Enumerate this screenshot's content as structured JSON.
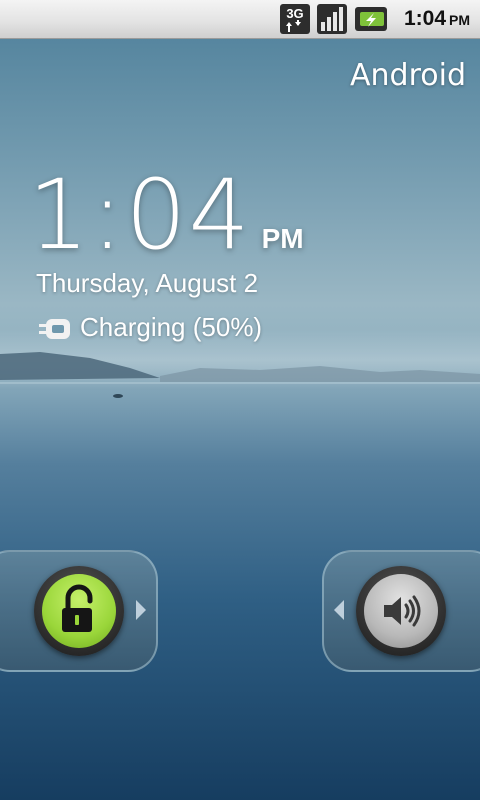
{
  "status_bar": {
    "network": "3G",
    "time": "1:04",
    "ampm": "PM",
    "icons": [
      "3g-data-icon",
      "signal-strength-icon",
      "battery-charging-icon"
    ]
  },
  "carrier": "Android",
  "clock": {
    "time": "1:04",
    "ampm": "PM"
  },
  "date": "Thursday, August 2",
  "charging": "Charging (50%)",
  "battery_level_percent": 50,
  "sliders": {
    "unlock_icon": "unlock-padlock-icon",
    "sound_icon": "speaker-volume-icon"
  },
  "colors": {
    "unlock_accent": "#9ad63a",
    "status_bar_bg": "#e4e4e4"
  }
}
